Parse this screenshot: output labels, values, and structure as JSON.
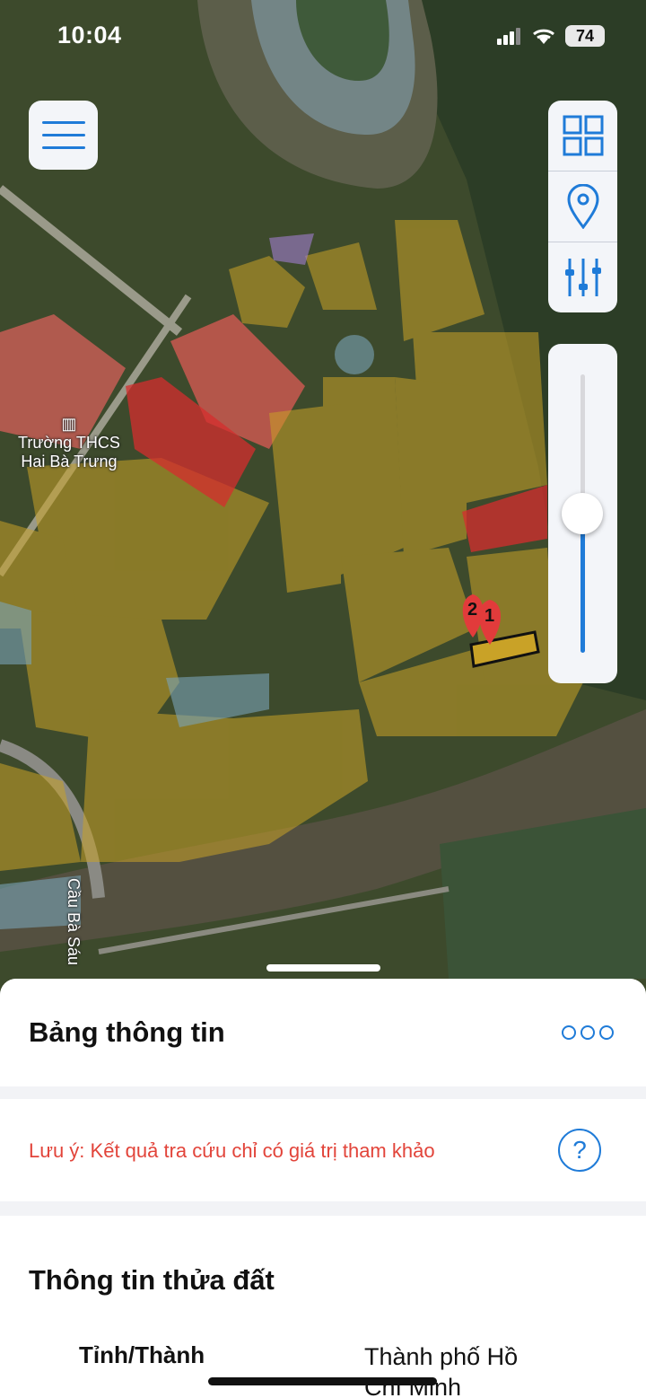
{
  "status_bar": {
    "time": "10:04",
    "battery": "74"
  },
  "map": {
    "labels": {
      "school": "Trường THCS\nHai Bà Trưng",
      "road": "Cầu Bà Sáu"
    },
    "markers": [
      "1",
      "2"
    ],
    "zoom_level": 0.5
  },
  "controls": {
    "menu_icon": "hamburger-icon",
    "tools": [
      "grid-layers-icon",
      "location-pin-icon",
      "sliders-icon"
    ]
  },
  "sheet": {
    "title": "Bảng thông tin",
    "note": "Lưu ý: Kết quả tra cứu chỉ có giá trị tham khảo",
    "help": "?",
    "section_title": "Thông tin thửa đất",
    "rows": [
      {
        "label": "Tỉnh/Thành",
        "value": "Thành phố Hồ Chí Minh"
      }
    ]
  },
  "colors": {
    "accent": "#1f7bd8",
    "warning": "#e2443a",
    "zone_yellow": "#c9a227",
    "zone_red": "#d62d2d"
  }
}
